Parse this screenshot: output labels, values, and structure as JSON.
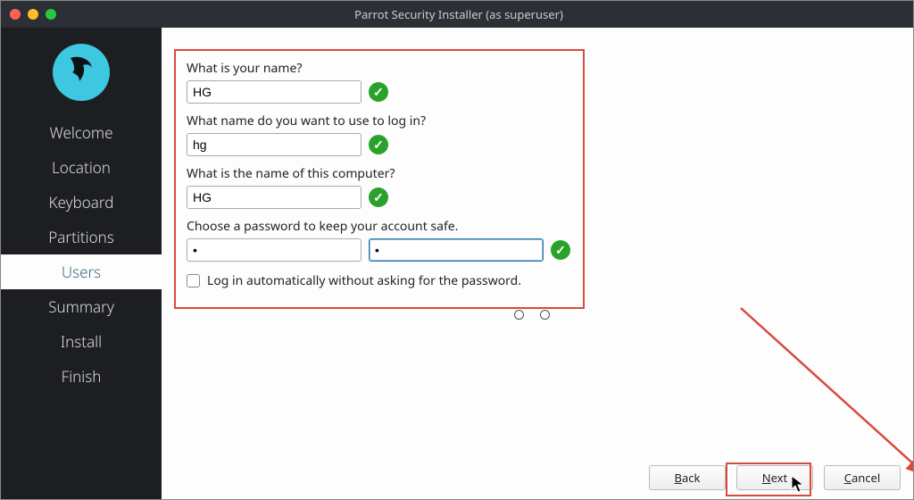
{
  "window": {
    "title": "Parrot Security Installer (as superuser)"
  },
  "sidebar": {
    "steps": [
      {
        "label": "Welcome"
      },
      {
        "label": "Location"
      },
      {
        "label": "Keyboard"
      },
      {
        "label": "Partitions"
      },
      {
        "label": "Users"
      },
      {
        "label": "Summary"
      },
      {
        "label": "Install"
      },
      {
        "label": "Finish"
      }
    ],
    "active_index": 4
  },
  "form": {
    "name_label": "What is your name?",
    "name_value": "HG",
    "login_label": "What name do you want to use to log in?",
    "login_value": "hg",
    "host_label": "What is the name of this computer?",
    "host_value": "HG",
    "pw_label": "Choose a password to keep your account safe.",
    "pw1_value": "•",
    "pw2_value": "•",
    "autologin_label": "Log in automatically without asking for the password."
  },
  "buttons": {
    "back": "Back",
    "next": "Next",
    "cancel": "Cancel"
  },
  "icons": {
    "check": "✓"
  }
}
